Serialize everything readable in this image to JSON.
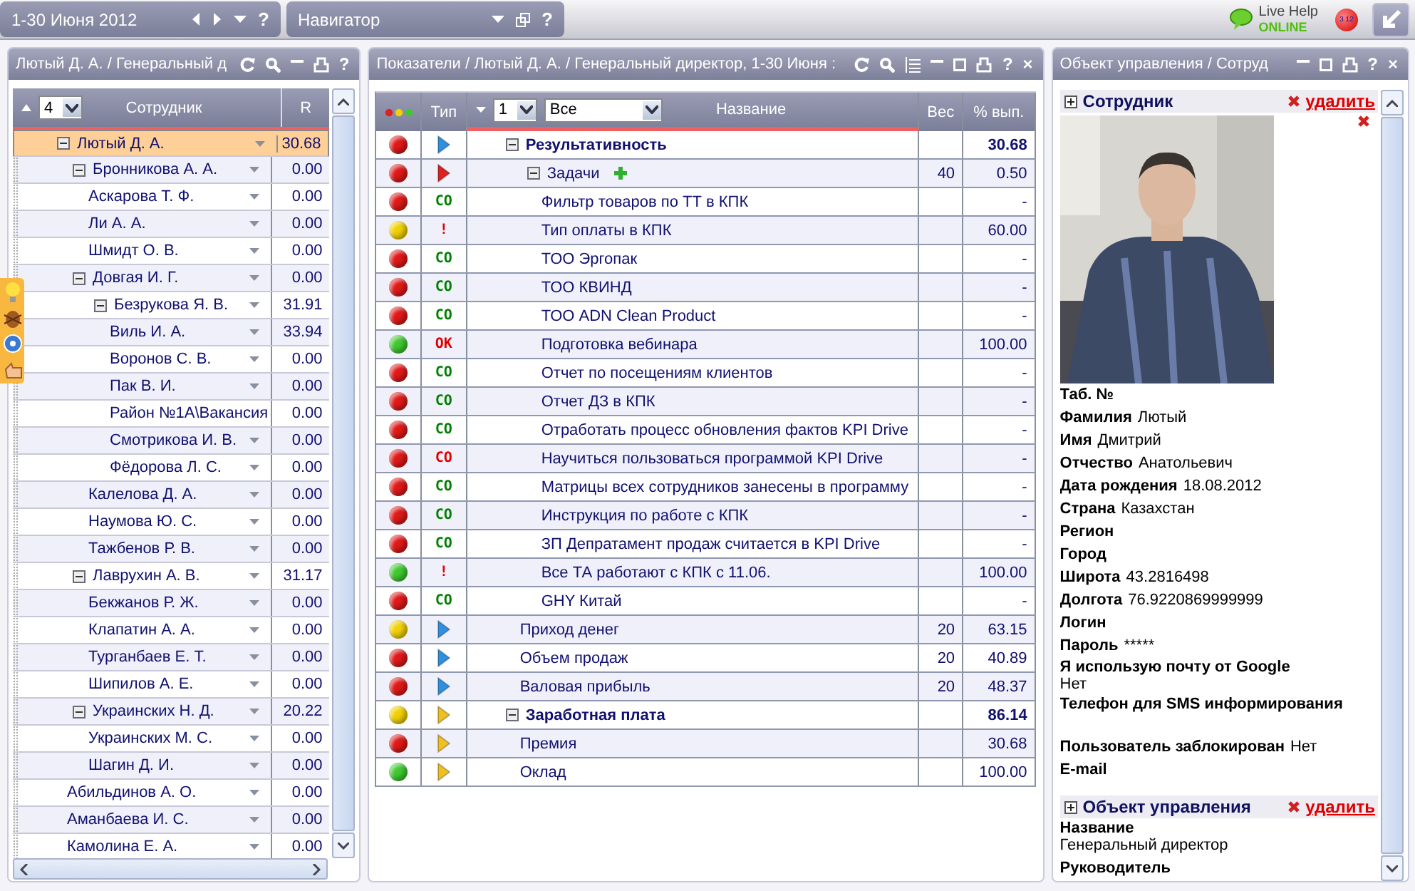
{
  "topbar": {
    "period": "1-30 Июня 2012",
    "period_help": "?",
    "navigator": "Навигатор",
    "navigator_help": "?",
    "live_help": "Live Help",
    "live_status": "ONLINE",
    "badge": "3 12"
  },
  "left": {
    "title": "Лютый Д. А. / Генеральный д",
    "help": "?",
    "level": "4",
    "columns": [
      "Сотрудник",
      "R"
    ],
    "tree": [
      {
        "name": "Лютый Д. А.",
        "r": "30.68",
        "selected": true,
        "menu": true,
        "expanded": true,
        "children": [
          {
            "name": "Бронникова А. А.",
            "r": "0.00",
            "selected": false,
            "menu": true,
            "expanded": true,
            "children": [
              {
                "name": "Аскарова Т. Ф.",
                "r": "0.00",
                "selected": false,
                "menu": true
              },
              {
                "name": "Ли А. А.",
                "r": "0.00",
                "selected": false,
                "menu": true
              },
              {
                "name": "Шмидт О. В.",
                "r": "0.00",
                "selected": false,
                "menu": true
              }
            ]
          },
          {
            "name": "Довгая И. Г.",
            "r": "0.00",
            "selected": false,
            "menu": true,
            "expanded": true,
            "children": [
              {
                "name": "Безрукова Я. В.",
                "r": "31.91",
                "selected": false,
                "menu": true,
                "expanded": true,
                "children": [
                  {
                    "name": "Виль И. А.",
                    "r": "33.94",
                    "selected": false,
                    "menu": true
                  },
                  {
                    "name": "Воронов С. В.",
                    "r": "0.00",
                    "selected": false,
                    "menu": true
                  },
                  {
                    "name": "Пак В. И.",
                    "r": "0.00",
                    "selected": false,
                    "menu": true
                  },
                  {
                    "name": "Район №1А\\Вакансия",
                    "r": "0.00",
                    "selected": false,
                    "menu": false
                  },
                  {
                    "name": "Смотрикова И. В.",
                    "r": "0.00",
                    "selected": false,
                    "menu": true
                  },
                  {
                    "name": "Фёдорова Л. С.",
                    "r": "0.00",
                    "selected": false,
                    "menu": true
                  }
                ]
              },
              {
                "name": "Калелова Д. А.",
                "r": "0.00",
                "selected": false,
                "menu": true
              },
              {
                "name": "Наумова Ю. С.",
                "r": "0.00",
                "selected": false,
                "menu": true
              },
              {
                "name": "Тажбенов Р. В.",
                "r": "0.00",
                "selected": false,
                "menu": true
              }
            ]
          },
          {
            "name": "Лаврухин А. В.",
            "r": "31.17",
            "selected": false,
            "menu": true,
            "expanded": true,
            "children": [
              {
                "name": "Бекжанов Р. Ж.",
                "r": "0.00",
                "selected": false,
                "menu": true
              },
              {
                "name": "Клапатин А. А.",
                "r": "0.00",
                "selected": false,
                "menu": true
              },
              {
                "name": "Турганбаев Е. Т.",
                "r": "0.00",
                "selected": false,
                "menu": true
              },
              {
                "name": "Шипилов А. Е.",
                "r": "0.00",
                "selected": false,
                "menu": true
              }
            ]
          },
          {
            "name": "Украинских Н. Д.",
            "r": "20.22",
            "selected": false,
            "menu": true,
            "expanded": true,
            "children": [
              {
                "name": "Украинских М. С.",
                "r": "0.00",
                "selected": false,
                "menu": true
              },
              {
                "name": "Шагин Д. И.",
                "r": "0.00",
                "selected": false,
                "menu": true
              }
            ]
          },
          {
            "name": "Абильдинов А. О.",
            "r": "0.00",
            "selected": false,
            "menu": true
          },
          {
            "name": "Аманбаева И. С.",
            "r": "0.00",
            "selected": false,
            "menu": true
          },
          {
            "name": "Камолина Е. А.",
            "r": "0.00",
            "selected": false,
            "menu": true
          }
        ]
      }
    ]
  },
  "middle": {
    "title": "Показатели / Лютый Д. А. / Генеральный директор, 1-30 Июня :",
    "help": "?",
    "close": "×",
    "type_col": "Тип",
    "level": "1",
    "filter": "Все",
    "columns": [
      "Название",
      "Вес",
      "% вып."
    ],
    "rows": [
      {
        "name": "Результативность",
        "color": "#e01818",
        "type": {
          "kind": "arrow",
          "color": "#2f8fe0"
        },
        "pct": "30.68",
        "add": false,
        "expanded": true,
        "children": [
          {
            "name": "Задачи",
            "color": "#e01818",
            "type": {
              "kind": "arrow",
              "color": "#e02020"
            },
            "weight": "40",
            "pct": "0.50",
            "add": true,
            "expanded": true,
            "children": [
              {
                "name": "Фильтр товаров по ТТ в КПК",
                "color": "#e01818",
                "type": {
                  "kind": "tag",
                  "text": "CO",
                  "color": "#008000"
                },
                "pct": "-",
                "add": false
              },
              {
                "name": "Тип оплаты в КПК",
                "color": "#f0d000",
                "type": {
                  "kind": "tag",
                  "text": "!",
                  "color": "#e00000"
                },
                "pct": "60.00",
                "add": false
              },
              {
                "name": "ТОО Эргопак",
                "color": "#e01818",
                "type": {
                  "kind": "tag",
                  "text": "CO",
                  "color": "#008000"
                },
                "pct": "-",
                "add": false
              },
              {
                "name": "ТОО КВИНД",
                "color": "#e01818",
                "type": {
                  "kind": "tag",
                  "text": "CO",
                  "color": "#008000"
                },
                "pct": "-",
                "add": false
              },
              {
                "name": "ТОО ADN Clean Product",
                "color": "#e01818",
                "type": {
                  "kind": "tag",
                  "text": "CO",
                  "color": "#008000"
                },
                "pct": "-",
                "add": false
              },
              {
                "name": "Подготовка вебинара",
                "color": "#40c830",
                "type": {
                  "kind": "tag",
                  "text": "OK",
                  "color": "#e00000"
                },
                "pct": "100.00",
                "add": false
              },
              {
                "name": "Отчет по посещениям клиентов",
                "color": "#e01818",
                "type": {
                  "kind": "tag",
                  "text": "CO",
                  "color": "#008000"
                },
                "pct": "-",
                "add": false
              },
              {
                "name": "Отчет ДЗ в КПК",
                "color": "#e01818",
                "type": {
                  "kind": "tag",
                  "text": "CO",
                  "color": "#008000"
                },
                "pct": "-",
                "add": false
              },
              {
                "name": "Отработать процесс обновления фактов KPI Drive",
                "color": "#e01818",
                "type": {
                  "kind": "tag",
                  "text": "CO",
                  "color": "#008000"
                },
                "pct": "-",
                "add": false
              },
              {
                "name": "Научиться пользоваться программой KPI Drive",
                "color": "#e01818",
                "type": {
                  "kind": "tag",
                  "text": "CO",
                  "color": "#e00000"
                },
                "pct": "-",
                "add": false
              },
              {
                "name": "Матрицы всех сотрудников занесены в программу",
                "color": "#e01818",
                "type": {
                  "kind": "tag",
                  "text": "CO",
                  "color": "#008000"
                },
                "pct": "-",
                "add": false
              },
              {
                "name": "Инструкция по работе с КПК",
                "color": "#e01818",
                "type": {
                  "kind": "tag",
                  "text": "CO",
                  "color": "#008000"
                },
                "pct": "-",
                "add": false
              },
              {
                "name": "ЗП Депратамент продаж считается в KPI Drive",
                "color": "#e01818",
                "type": {
                  "kind": "tag",
                  "text": "CO",
                  "color": "#008000"
                },
                "pct": "-",
                "add": false
              },
              {
                "name": "Все ТА работают с КПК с 11.06.",
                "color": "#40c830",
                "type": {
                  "kind": "tag",
                  "text": "!",
                  "color": "#e00000"
                },
                "pct": "100.00",
                "add": false
              },
              {
                "name": "GHY Китай",
                "color": "#e01818",
                "type": {
                  "kind": "tag",
                  "text": "CO",
                  "color": "#008000"
                },
                "pct": "-",
                "add": false
              }
            ]
          },
          {
            "name": "Приход денег",
            "color": "#f0d000",
            "type": {
              "kind": "arrow",
              "color": "#2f8fe0"
            },
            "weight": "20",
            "pct": "63.15",
            "add": false
          },
          {
            "name": "Объем продаж",
            "color": "#e01818",
            "type": {
              "kind": "arrow",
              "color": "#2f8fe0"
            },
            "weight": "20",
            "pct": "40.89",
            "add": false
          },
          {
            "name": "Валовая прибыль",
            "color": "#e01818",
            "type": {
              "kind": "arrow",
              "color": "#2f8fe0"
            },
            "weight": "20",
            "pct": "48.37",
            "add": false
          }
        ]
      },
      {
        "name": "Заработная плата",
        "color": "#f0d000",
        "type": {
          "kind": "arrow",
          "color": "#f0c020"
        },
        "pct": "86.14",
        "add": false,
        "expanded": true,
        "children": [
          {
            "name": "Премия",
            "color": "#e01818",
            "type": {
              "kind": "arrow",
              "color": "#f0c020"
            },
            "pct": "30.68",
            "add": false
          },
          {
            "name": "Оклад",
            "color": "#40c830",
            "type": {
              "kind": "arrow",
              "color": "#f0c020"
            },
            "pct": "100.00",
            "add": false
          }
        ]
      }
    ]
  },
  "right": {
    "title": "Объект управления / Сотруд",
    "help": "?",
    "close": "×",
    "sections": [
      {
        "title": "Сотрудник",
        "delete": "удалить",
        "fields": [
          {
            "kind": "inline",
            "label": "Таб. №"
          },
          {
            "kind": "inline",
            "label": "Фамилия",
            "value": "Лютый"
          },
          {
            "kind": "inline",
            "label": "Имя",
            "value": "Дмитрий"
          },
          {
            "kind": "inline",
            "label": "Отчество",
            "value": "Анатольевич"
          },
          {
            "kind": "inline",
            "label": "Дата рождения",
            "value": "18.08.2012"
          },
          {
            "kind": "inline",
            "label": "Страна",
            "value": "Казахстан"
          },
          {
            "kind": "inline",
            "label": "Регион"
          },
          {
            "kind": "inline",
            "label": "Город"
          },
          {
            "kind": "inline",
            "label": "Широта",
            "value": "43.2816498"
          },
          {
            "kind": "inline",
            "label": "Долгота",
            "value": "76.9220869999999"
          },
          {
            "kind": "inline",
            "label": "Логин"
          },
          {
            "kind": "inline",
            "label": "Пароль",
            "value": "*****"
          },
          {
            "kind": "stacked",
            "label": "Я использую почту от Google",
            "value": "Нет"
          },
          {
            "kind": "stacked",
            "label": "Телефон для SMS информирования"
          },
          {
            "kind": "inline",
            "label": "Пользователь заблокирован",
            "value": "Нет"
          },
          {
            "kind": "inline",
            "label": "E-mail"
          }
        ]
      },
      {
        "title": "Объект управления",
        "delete": "удалить",
        "fields": [
          {
            "kind": "stacked",
            "label": "Название",
            "value": "Генеральный директор"
          },
          {
            "kind": "inline",
            "label": "Руководитель"
          }
        ]
      }
    ]
  }
}
